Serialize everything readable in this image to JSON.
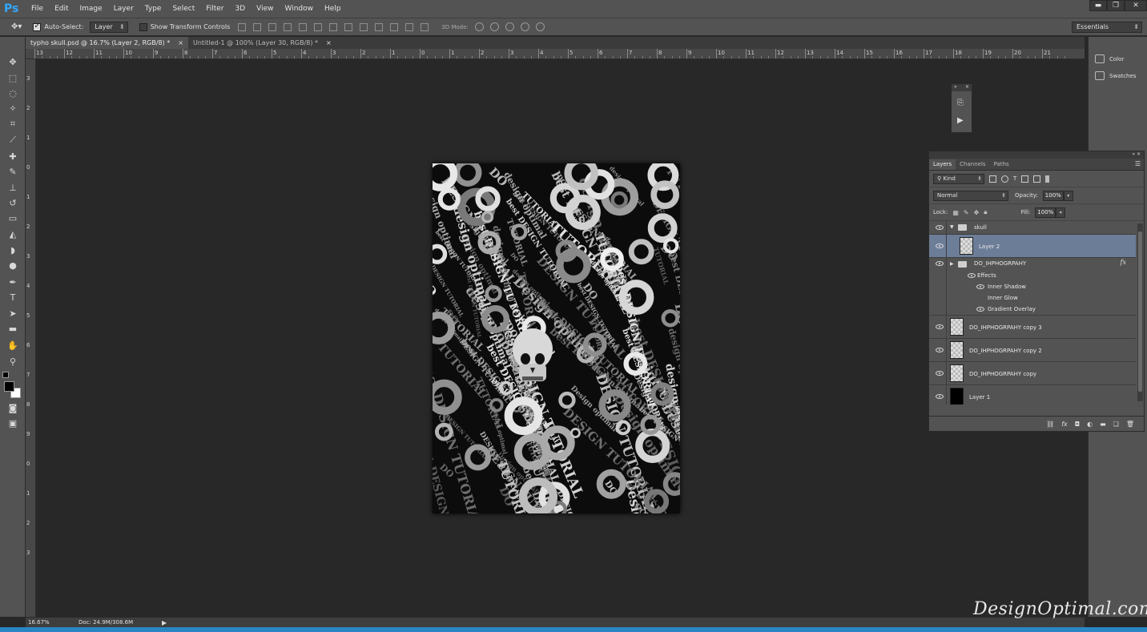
{
  "app": {
    "logo": "Ps"
  },
  "menu": [
    "File",
    "Edit",
    "Image",
    "Layer",
    "Type",
    "Select",
    "Filter",
    "3D",
    "View",
    "Window",
    "Help"
  ],
  "window_controls": {
    "minimize": "▬",
    "restore": "❐",
    "close": "✕"
  },
  "options": {
    "auto_select_label": "Auto-Select:",
    "auto_select_checked": true,
    "auto_select_target": "Layer",
    "show_transform_label": "Show Transform Controls",
    "show_transform_checked": false,
    "mode3d_label": "3D Mode:",
    "workspace": "Essentials"
  },
  "tabs": [
    {
      "label": "typho skull.psd @ 16.7% (Layer 2, RGB/8) *",
      "close": "×",
      "active": true
    },
    {
      "label": "Untitled-1 @ 100% (Layer 30, RGB/8) *",
      "close": "×",
      "active": false
    }
  ],
  "ruler_top": [
    "13",
    "12",
    "11",
    "10",
    "9",
    "8",
    "7",
    "6",
    "5",
    "4",
    "3",
    "2",
    "1",
    "0",
    "1",
    "2",
    "3",
    "4",
    "5",
    "6",
    "7",
    "8",
    "9",
    "10",
    "11",
    "12",
    "13",
    "14",
    "15",
    "16",
    "17",
    "18",
    "19",
    "20",
    "21"
  ],
  "ruler_left": [
    "3",
    "2",
    "1",
    "0",
    "1",
    "2",
    "3",
    "4",
    "5",
    "6",
    "7",
    "8",
    "9",
    "0",
    "1",
    "2",
    "3"
  ],
  "status": {
    "zoom": "16.67%",
    "doc": "Doc: 24.9M/308.6M",
    "arrow": "▶"
  },
  "right_panels": [
    {
      "label": "Color",
      "icon": "color-palette-icon"
    },
    {
      "label": "Swatches",
      "icon": "swatches-grid-icon"
    }
  ],
  "actions_panel": {
    "collapse": "»",
    "close": "×",
    "play": "▶",
    "history": "⎘"
  },
  "layers_panel": {
    "tabs": [
      "Layers",
      "Channels",
      "Paths"
    ],
    "filter_kind": "Kind",
    "blend_mode": "Normal",
    "opacity_label": "Opacity:",
    "opacity_value": "100%",
    "lock_label": "Lock:",
    "fill_label": "Fill:",
    "fill_value": "100%",
    "layers": [
      {
        "name": "skull",
        "type": "group",
        "expanded": true,
        "indent": 0
      },
      {
        "name": "Layer 2",
        "type": "layer",
        "selected": true,
        "indent": 1
      },
      {
        "name": "DO_IHPHOGRPAHY",
        "type": "group",
        "expanded": false,
        "fx": "fx",
        "indent": 1
      },
      {
        "name": "Effects",
        "type": "effect-header"
      },
      {
        "name": "Inner Shadow",
        "type": "effect",
        "visible": true
      },
      {
        "name": "Inner Glow",
        "type": "effect",
        "visible": false
      },
      {
        "name": "Gradient Overlay",
        "type": "effect",
        "visible": true
      },
      {
        "name": "DO_IHPHOGRPAHY copy 3",
        "type": "layer"
      },
      {
        "name": "DO_IHPHOGRPAHY copy 2",
        "type": "layer"
      },
      {
        "name": "DO_IHPHOGRPAHY copy",
        "type": "layer"
      },
      {
        "name": "Layer 1",
        "type": "layer",
        "thumb": "black"
      }
    ]
  },
  "canvas_art": {
    "text_fragments": [
      "best DESIGN TUTORIAL",
      "Design optimal",
      "DESIGN TUTORIAL",
      "TUTORIAL",
      "design optimal",
      "DO"
    ]
  },
  "watermark": "DesignOptimal.com"
}
